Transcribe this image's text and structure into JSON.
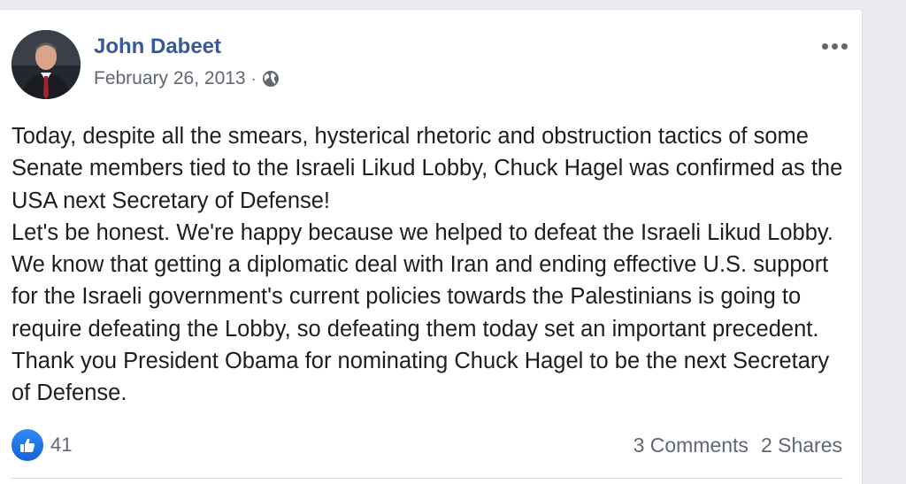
{
  "post": {
    "author": "John Dabeet",
    "date": "February 26, 2013",
    "separator": "·",
    "privacy_icon": "globe-icon",
    "paragraphs": [
      "Today, despite all the smears, hysterical rhetoric and obstruction tactics of some Senate members tied to the Israeli Likud Lobby, Chuck Hagel was confirmed as the USA next Secretary of Defense!",
      "Let's be honest. We're happy because we helped to defeat the Israeli Likud Lobby. We know that getting a diplomatic deal with Iran and ending effective U.S. support for the Israeli government's current policies towards the Palestinians is going to require defeating the Lobby, so defeating them today set an important precedent. Thank you President Obama for nominating Chuck Hagel to be the next Secretary of Defense."
    ]
  },
  "reactions": {
    "like_count": "41",
    "comments": "3 Comments",
    "shares": "2 Shares"
  },
  "colors": {
    "author_link": "#385898",
    "like_blue": "#1877f2",
    "secondary_text": "#606770"
  }
}
